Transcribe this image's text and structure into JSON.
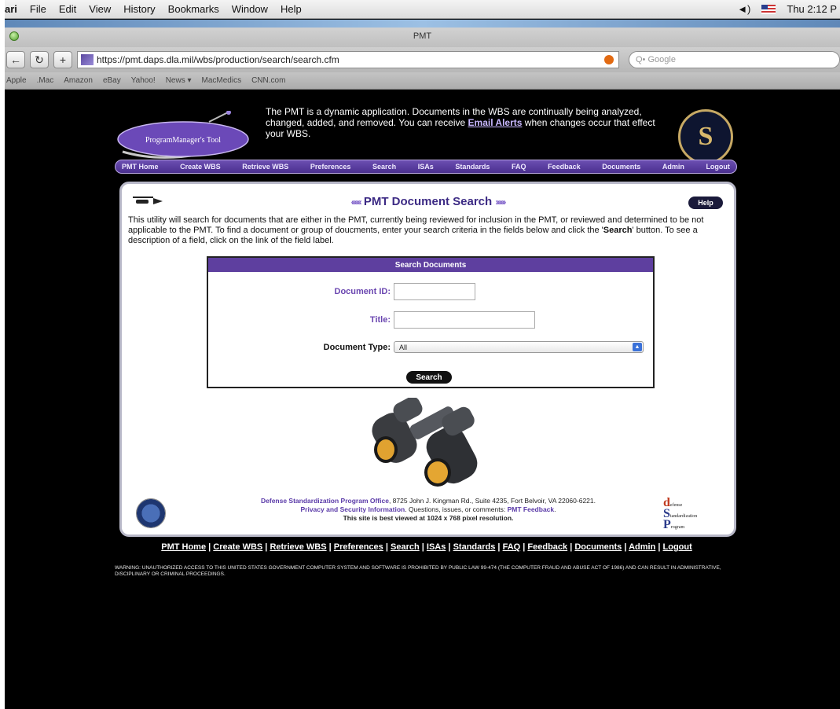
{
  "menubar": {
    "app": "ari",
    "items": [
      "File",
      "Edit",
      "View",
      "History",
      "Bookmarks",
      "Window",
      "Help"
    ],
    "clock": "Thu 2:12 P"
  },
  "browser": {
    "window_title": "PMT",
    "url": "https://pmt.daps.dla.mil/wbs/production/search/search.cfm",
    "search_placeholder": "Q• Google",
    "bookmarks": [
      "Apple",
      ".Mac",
      "Amazon",
      "eBay",
      "Yahoo!",
      "News ▾",
      "MacMedics",
      "CNN.com"
    ]
  },
  "header": {
    "logo_text": "ProgramManager's Tool",
    "blurb_pre": "The PMT is a dynamic application. Documents in the WBS are continually being analyzed, changed, added, and removed. You can receive ",
    "blurb_link": "Email Alerts",
    "blurb_post": " when changes occur that effect your WBS.",
    "seal_letters": "S"
  },
  "nav": [
    "PMT Home",
    "Create WBS",
    "Retrieve WBS",
    "Preferences",
    "Search",
    "ISAs",
    "Standards",
    "FAQ",
    "Feedback",
    "Documents",
    "Admin",
    "Logout"
  ],
  "search_page": {
    "title": "PMT Document Search",
    "help_label": "Help",
    "intro_pre": "This utility will search for documents that are either in the PMT, currently being reviewed for inclusion in the PMT, or reviewed and determined to be not applicable to the PMT. To find a document or group of doucments, enter your search criteria in the fields below and click the '",
    "intro_bold": "Search",
    "intro_post": "' button. To see a description of a field, click on the link of the field label.",
    "box_title": "Search Documents",
    "doc_id_label": "Document ID:",
    "doc_id_value": "",
    "title_label": "Title:",
    "title_value": "",
    "doc_type_label": "Document Type:",
    "doc_type_value": "All",
    "search_button": "Search"
  },
  "footer": {
    "org_name": "Defense Standardization Program Office",
    "address": ", 8725 John J. Kingman Rd., Suite 4235, Fort Belvoir, VA 22060-6221.",
    "privacy": "Privacy and Security Information",
    "questions": ". Questions, issues, or comments: ",
    "feedback": "PMT Feedback",
    "period": ".",
    "best_viewed": "This site is best viewed at 1024 x 768 pixel resolution.",
    "dsp_line1": "efense",
    "dsp_line2": "tandardization",
    "dsp_line3": "rogram"
  },
  "bottom_links": [
    "PMT Home",
    "Create WBS",
    "Retrieve WBS",
    "Preferences",
    "Search",
    "ISAs",
    "Standards",
    "FAQ",
    "Feedback",
    "Documents",
    "Admin",
    "Logout"
  ],
  "warning": "WARNING: UNAUTHORIZED ACCESS TO THIS UNITED STATES GOVERNMENT COMPUTER SYSTEM AND SOFTWARE IS PROHIBITED BY PUBLIC LAW 99-474 (THE COMPUTER FRAUD AND ABUSE ACT OF 1986) AND CAN RESULT IN ADMINISTRATIVE, DISCIPLINARY OR CRIMINAL PROCEEDINGS."
}
